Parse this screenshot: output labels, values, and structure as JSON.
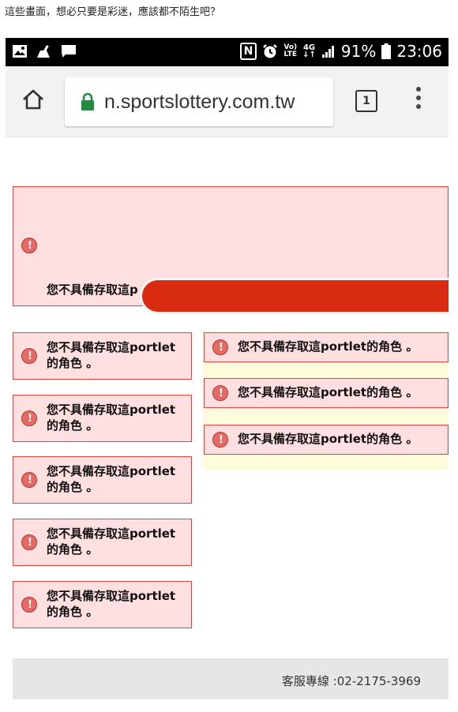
{
  "caption": "這些畫面，想必只要是彩迷，應該都不陌生吧？",
  "status_bar": {
    "left_icons": [
      "gallery-icon",
      "broom-icon",
      "message-icon"
    ],
    "nfc": "N",
    "volte_top": "Vo)",
    "volte_bottom": "LTE",
    "net_top": "4G",
    "net_bottom": "↓↑",
    "battery": "91%",
    "time": "23:06"
  },
  "browser": {
    "url": "n.sportslottery.com.tw",
    "tab_count": "1"
  },
  "errors": {
    "top": "您不具備存取這p",
    "left": [
      {
        "line1": "您不具備存取這portlet",
        "line2": "的角色 。"
      },
      {
        "line1": "您不具備存取這portlet",
        "line2": "的角色 。"
      },
      {
        "line1": "您不具備存取這portlet",
        "line2": "的角色 。"
      },
      {
        "line1": "您不具備存取這portlet",
        "line2": "的角色 。"
      },
      {
        "line1": "您不具備存取這portlet",
        "line2": "的角色 。"
      }
    ],
    "right": [
      "您不具備存取這portlet的角色 。",
      "您不具備存取這portlet的角色 。",
      "您不具備存取這portlet的角色 。"
    ]
  },
  "footer": {
    "hotline": "客服專線 :02-2175-3969"
  },
  "colors": {
    "error_bg": "#ffdfdf",
    "error_border": "#e0433b",
    "banner_red": "#d92a12",
    "secure_green": "#1e8e3e"
  }
}
